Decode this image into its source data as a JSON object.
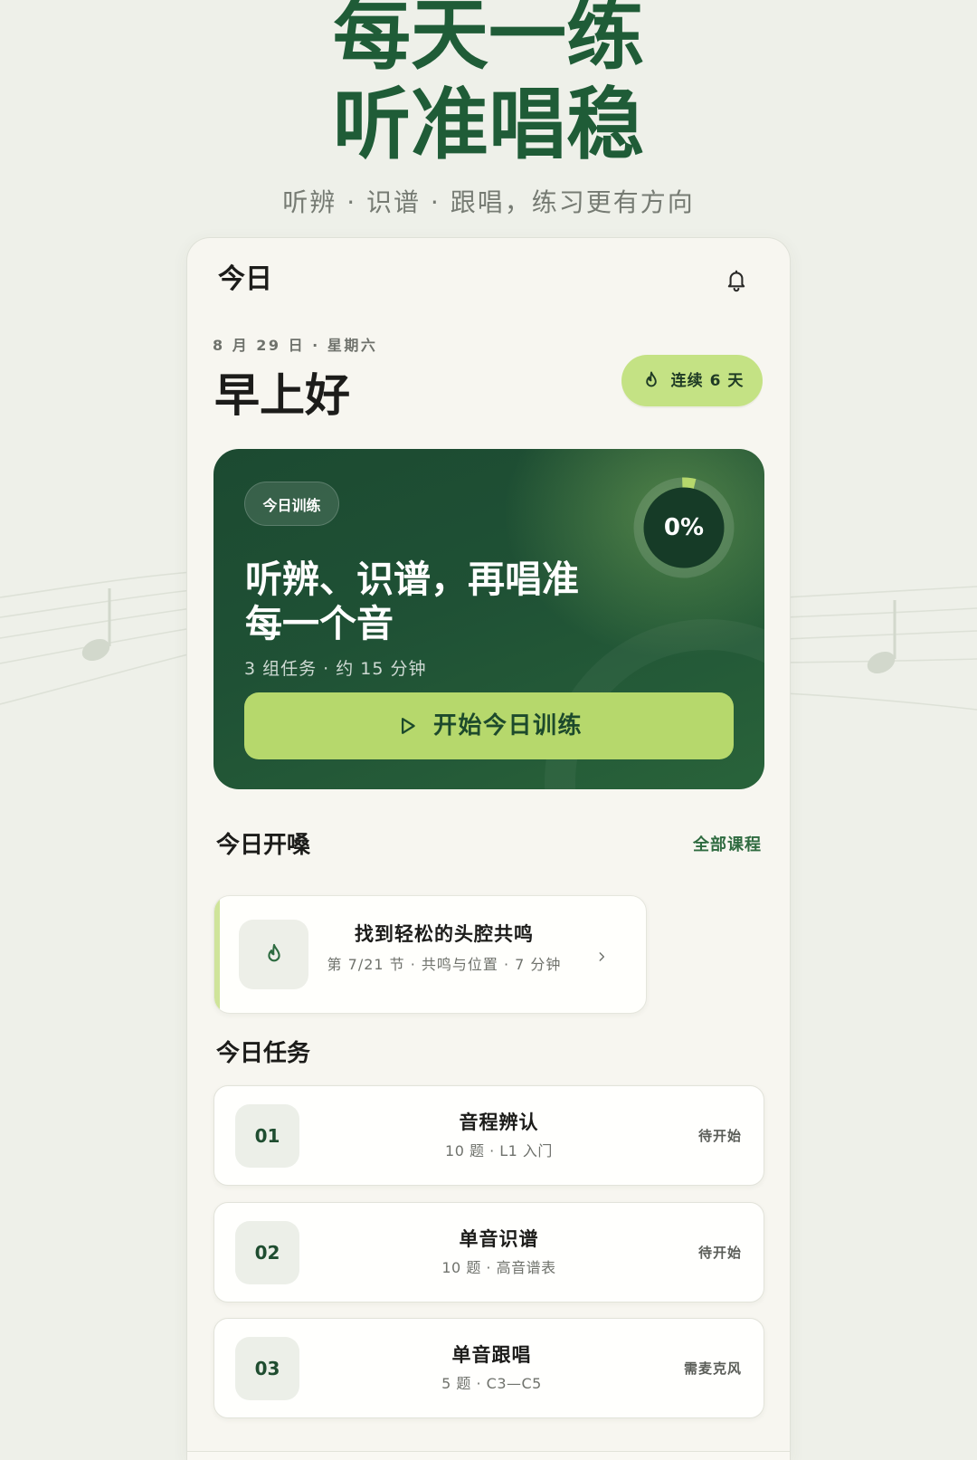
{
  "promo": {
    "headline_lines": [
      "每天一练",
      "听准唱稳"
    ],
    "tagline": "听辨 · 识谱 · 跟唱，练习更有方向"
  },
  "header": {
    "title": "今日",
    "notification_icon": "bell-icon"
  },
  "greeting": {
    "date": "8 月 29 日 · 星期六",
    "salutation": "早上好"
  },
  "streak": {
    "icon": "flame-icon",
    "label": "连续 6 天"
  },
  "hero": {
    "tag": "今日训练",
    "progress_label": "0%",
    "heading_lines": [
      "听辨、识谱，再唱准",
      "每一个音"
    ],
    "meta": "3 组任务 · 约 15 分钟",
    "start_button": {
      "icon": "play-icon",
      "label": "开始今日训练"
    }
  },
  "warmup": {
    "section_title": "今日开嗓",
    "all_courses_link": "全部课程",
    "lesson": {
      "icon": "flame-icon",
      "title": "找到轻松的头腔共鸣",
      "meta": "第 7/21 节 · 共鸣与位置 · 7 分钟",
      "action_icon": "chevron-right-icon"
    }
  },
  "tasks": {
    "section_title": "今日任务",
    "items": [
      {
        "number": "01",
        "title": "音程辨认",
        "meta": "10 题 · L1 入门",
        "status": "待开始"
      },
      {
        "number": "02",
        "title": "单音识谱",
        "meta": "10 题 · 高音谱表",
        "status": "待开始"
      },
      {
        "number": "03",
        "title": "单音跟唱",
        "meta": "5 题 · C3—C5",
        "status": "需麦克风"
      }
    ]
  },
  "theme": {
    "brand": "#1f5c37",
    "accent_lime": "#b6d86c",
    "background": "#eef0e9",
    "surface": "#f7f6f0"
  }
}
